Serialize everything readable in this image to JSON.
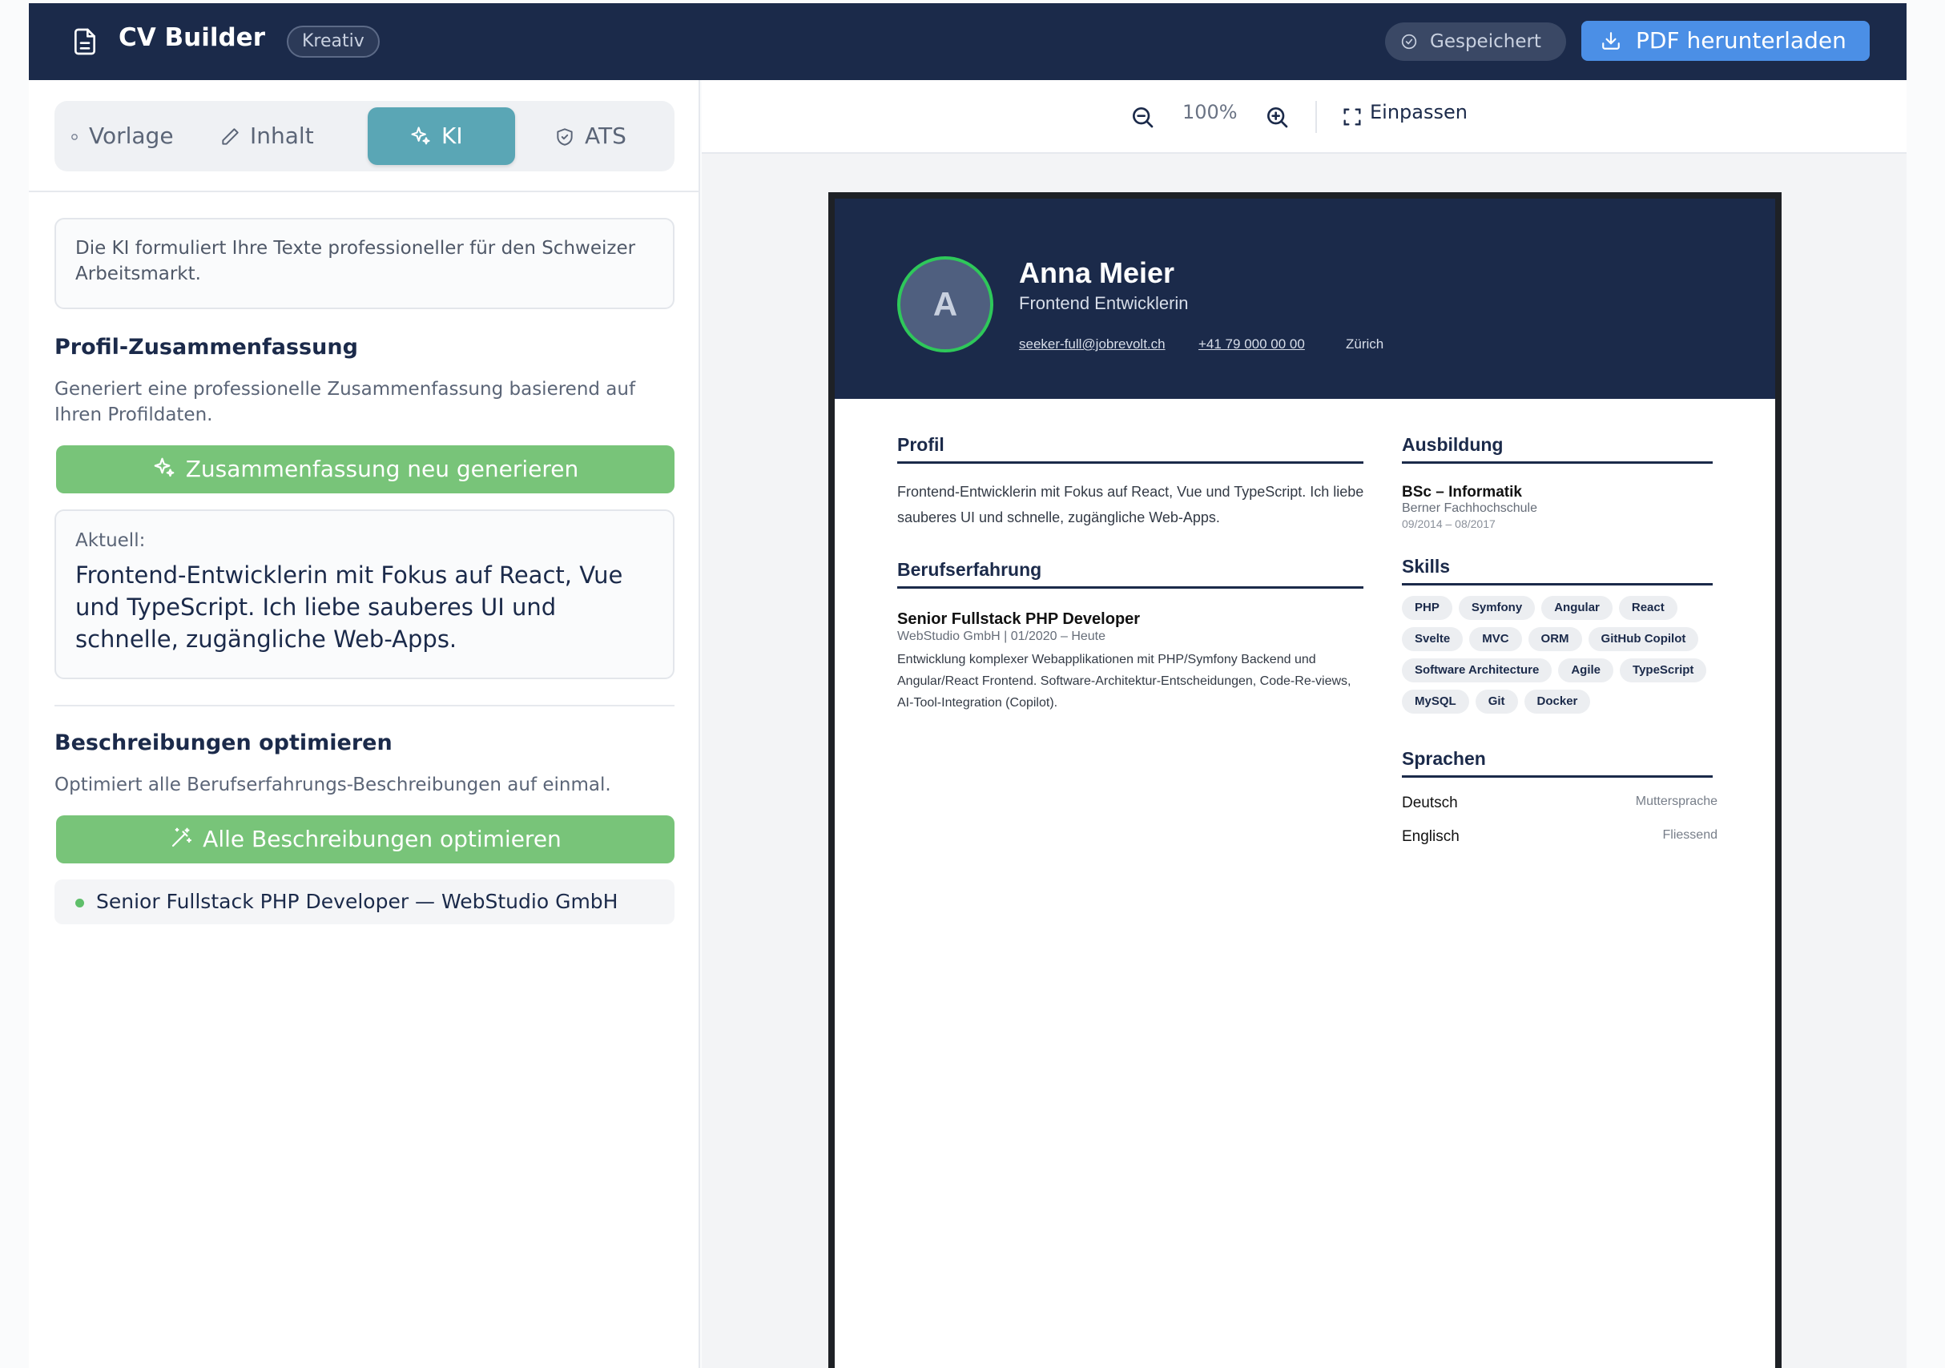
{
  "header": {
    "app_title": "CV Builder",
    "template_badge": "Kreativ",
    "saved_label": "Gespeichert",
    "pdf_label": "PDF herunterladen"
  },
  "sidebar": {
    "tabs": [
      {
        "label": "Vorlage",
        "icon": "dot-icon"
      },
      {
        "label": "Inhalt",
        "icon": "pencil-icon"
      },
      {
        "label": "KI",
        "icon": "sparkles-icon"
      },
      {
        "label": "ATS",
        "icon": "shield-check-icon"
      }
    ],
    "active_tab": "KI",
    "info_text": "Die KI formuliert Ihre Texte professioneller für den Schweizer Arbeitsmarkt.",
    "summary": {
      "title": "Profil-Zusammenfassung",
      "description": "Generiert eine professionelle Zusammenfassung basierend auf Ihren Profildaten.",
      "button_label": "Zusammenfassung neu generieren",
      "current_label": "Aktuell:",
      "current_text": "Frontend-Entwicklerin mit Fokus auf React, Vue und TypeScript. Ich liebe sauberes UI und schnelle, zugängliche Web-Apps."
    },
    "optimize": {
      "title": "Beschreibungen optimieren",
      "description": "Optimiert alle Berufserfahrungs-Beschreibungen auf einmal.",
      "button_label": "Alle Beschreibungen optimieren",
      "items": [
        "Senior Fullstack PHP Developer — WebStudio GmbH"
      ]
    }
  },
  "preview_toolbar": {
    "zoom": "100%",
    "fit_label": "Einpassen"
  },
  "cv": {
    "initial": "A",
    "name": "Anna Meier",
    "role": "Frontend Entwicklerin",
    "email": "seeker-full@jobrevolt.ch",
    "phone": "+41 79 000 00 00",
    "city": "Zürich",
    "profile_title": "Profil",
    "profile_text": "Frontend-Entwicklerin mit Fokus auf React, Vue und TypeScript. Ich liebe sauberes UI und schnelle, zugängliche Web-Apps.",
    "experience_title": "Berufserfahrung",
    "experience": {
      "position": "Senior Fullstack PHP Developer",
      "company_period": "WebStudio GmbH | 01/2020 – Heute",
      "description": "Entwicklung komplexer Webapplikationen mit PHP/Symfony Backend und Angular/React Frontend. Software-Architektur-Entscheidungen, Code-Re-views, AI-Tool-Integration (Copilot)."
    },
    "education_title": "Ausbildung",
    "education": {
      "degree": "BSc – Informatik",
      "school": "Berner Fachhochschule",
      "period": "09/2014 – 08/2017"
    },
    "skills_title": "Skills",
    "skills": [
      "PHP",
      "Symfony",
      "Angular",
      "React",
      "Svelte",
      "MVC",
      "ORM",
      "GitHub Copilot",
      "Software Architecture",
      "Agile",
      "TypeScript",
      "MySQL",
      "Git",
      "Docker"
    ],
    "languages_title": "Sprachen",
    "languages": [
      {
        "name": "Deutsch",
        "level": "Muttersprache"
      },
      {
        "name": "Englisch",
        "level": "Fliessend"
      }
    ]
  },
  "colors": {
    "navy": "#1b2a4a",
    "accent_teal": "#5aa6b5",
    "green": "#78c479",
    "blue": "#4b8fe6",
    "avatar_ring": "#2ec85a"
  }
}
